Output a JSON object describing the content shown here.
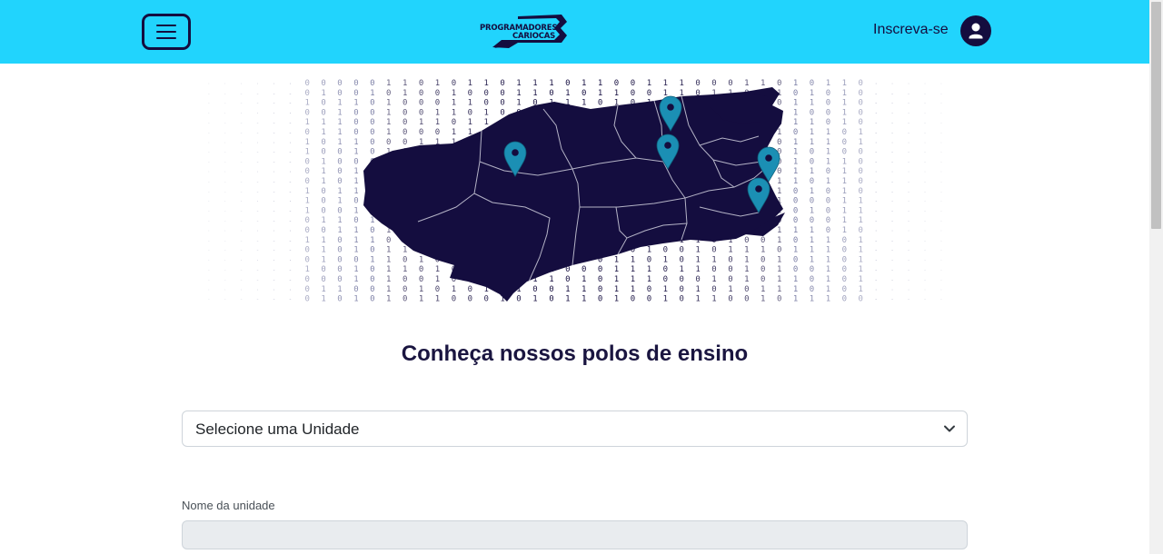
{
  "header": {
    "logo_line1": "PROGRAMADORES",
    "logo_line2": "CARIOCAS",
    "signup_label": "Inscreva-se",
    "brand_color": "#21d4fd",
    "dark_color": "#140d3f"
  },
  "hero": {
    "binary_rows": [
      "1101000000011010110111011001110001101011000101",
      "0110110100101001000110101100110110110101010101",
      "1101001011010001100101110101110010101101010110",
      "1010100010010011010010110101011011101001010110",
      "0100101110010110110011010100111010011101010110",
      "1011100110010001101101010110001011010110101011",
      "0011101011000111010011011011010101101110100111",
      "1101011001010110101101000101110101101010010101",
      "0110110100010101011011100011010111001011011101",
      "1011100101101010010010101110110100101101010110",
      "0011110101100101101011000100101011011011010010",
      "1101001011110001101101101011011011010101010110",
      "0100111010011011000110111001101010110001101101",
      "1001011001001011011010111100100110110101101010",
      "0110110110101101000101101101011110100001110101",
      "1011010011011010011101001110010101011101010001",
      "0101001101101010110110101000111010010110101100",
      "1101100101011010110101011001001011101110101011",
      "0110110100110101100111010110101101010110110100",
      "1001011001011010101011000111011001010010101010",
      "1101110001010010111011010111000101011010110101",
      "0010100110010101010100110110101010111010101001",
      "1111100101010110001010110100101100101110011111"
    ],
    "marker_icon": "map-pin-icon",
    "marker_color": "#1b8fb4"
  },
  "main": {
    "title": "Conheça nossos polos de ensino",
    "select_value": "Selecione uma Unidade",
    "unit_name_label": "Nome da unidade",
    "unit_name_value": ""
  }
}
